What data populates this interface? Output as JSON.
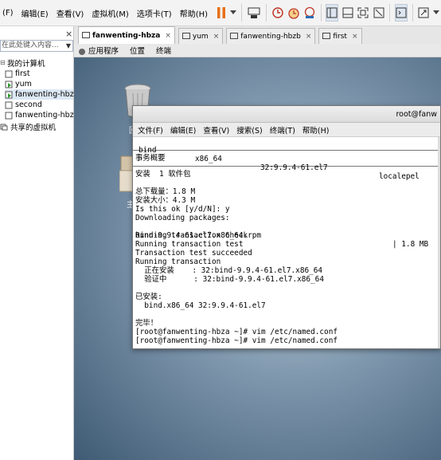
{
  "menubar": {
    "items": [
      "(F)",
      "编辑(E)",
      "查看(V)",
      "虚拟机(M)",
      "选项卡(T)",
      "帮助(H)"
    ]
  },
  "sidebar": {
    "close": "×",
    "search_placeholder": "在此处键入内容...",
    "my_computer": "我的计算机",
    "vms": [
      "first",
      "yum",
      "fanwenting-hbza",
      "second",
      "fanwenting-hbzb"
    ],
    "shared": "共享的虚拟机"
  },
  "tabs": [
    {
      "label": "fanwenting-hbza",
      "active": true
    },
    {
      "label": "yum",
      "active": false
    },
    {
      "label": "fanwenting-hbzb",
      "active": false
    },
    {
      "label": "first",
      "active": false
    }
  ],
  "tab_close": "×",
  "gnome_panel": {
    "apps": "应用程序",
    "places": "位置",
    "terminal": "终端"
  },
  "desktop": {
    "icon1_label": "回",
    "icon2_label": "主"
  },
  "terminal": {
    "title": "root@fanw",
    "menu": [
      "文件(F)",
      "编辑(E)",
      "查看(V)",
      "搜索(S)",
      "终端(T)",
      "帮助(H)"
    ],
    "row_pkg": {
      "name": "bind",
      "arch": "x86_64",
      "version": "32:9.9.4-61.el7",
      "repo": "localepel"
    },
    "summary": "事务概要",
    "install_count": "安装  1 软件包",
    "total_download": "总下载量：1.8 M",
    "install_size": "安装大小：4.3 M",
    "prompt_ok": "Is this ok [y/d/N]: y",
    "downloading": "Downloading packages:",
    "rpm": "bind-9.9.4-61.el7.x86_64.rpm",
    "rpm_size": "| 1.8 MB",
    "check": "Running transaction check",
    "test": "Running transaction test",
    "succeeded": "Transaction test succeeded",
    "running": "Running transaction",
    "installing": "  正在安装    : 32:bind-9.9.4-61.el7.x86_64",
    "verifying": "  验证中      : 32:bind-9.9.4-61.el7.x86_64",
    "installed_header": "已安装:",
    "installed_pkg": "  bind.x86_64 32:9.9.4-61.el7",
    "done": "完毕！",
    "cmd1": "[root@fanwenting-hbza ~]# vim /etc/named.conf",
    "cmd2": "[root@fanwenting-hbza ~]# vim /etc/named.conf"
  }
}
